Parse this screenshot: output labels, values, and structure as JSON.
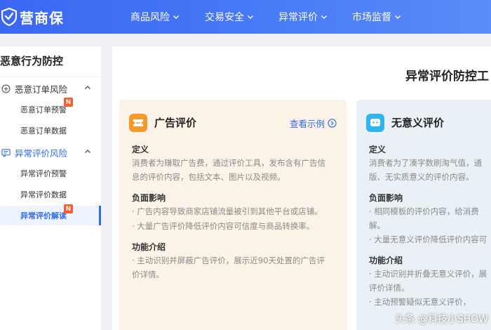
{
  "logo": {
    "text": "营商保"
  },
  "nav": [
    {
      "label": "商品风险"
    },
    {
      "label": "交易安全"
    },
    {
      "label": "异常评价"
    },
    {
      "label": "市场监督"
    }
  ],
  "sidebar": {
    "title": "恶意行为防控",
    "groups": [
      {
        "label": "恶意订单风险",
        "icon": "plus-circle-icon",
        "items": [
          {
            "label": "恶意订单预警",
            "badge": "N"
          },
          {
            "label": "恶意订单数据"
          }
        ]
      },
      {
        "label": "异常评价风险",
        "icon": "comment-icon",
        "items": [
          {
            "label": "异常评价预警"
          },
          {
            "label": "异常评价数据"
          },
          {
            "label": "异常评价解读",
            "badge": "N",
            "active": true
          }
        ]
      }
    ]
  },
  "main": {
    "title": "异常评价防控工",
    "cards": [
      {
        "title": "广告评价",
        "icon": "ticket-icon",
        "icon_color": "#f39a2b",
        "link": "查看示例",
        "sections": [
          {
            "heading": "定义",
            "lines": [
              "消费者为赚取广告费，通过评价工具，发布含有广告信",
              "息的评价内容，包括文本、图片以及视频。"
            ]
          },
          {
            "heading": "负面影响",
            "lines": [
              "· 广告内容导致商家店铺流量被引到其他平台或店铺。",
              "· 大量广告评价降低评价内容可信度与商品转换率。"
            ]
          },
          {
            "heading": "功能介绍",
            "lines": [
              "· 主动识别并屏蔽广告评价，展示近90天处置的广告评",
              "  价详情。"
            ]
          }
        ]
      },
      {
        "title": "无意义评价",
        "icon": "chat-bubble-icon",
        "icon_color": "#2fb4ec",
        "sections": [
          {
            "heading": "定义",
            "lines": [
              "消费者为了凑字数刷淘气值，通",
              "版、无实质意义的评价内容。"
            ]
          },
          {
            "heading": "负面影响",
            "lines": [
              "· 相同模板的评价内容，给消费",
              "  解。",
              "· 大量无意义评价降低评价内容可"
            ]
          },
          {
            "heading": "功能介绍",
            "lines": [
              "· 主动识别并折叠无意义评价，展",
              "  评价详情。",
              "· 主动预警疑似无意义评价，"
            ]
          }
        ]
      }
    ]
  },
  "watermark": "头条 @科技小SHOW",
  "colors": {
    "nav_blue": "#3a67f2",
    "accent_blue": "#2f6bf0",
    "badge_orange": "#ff5a2c"
  }
}
